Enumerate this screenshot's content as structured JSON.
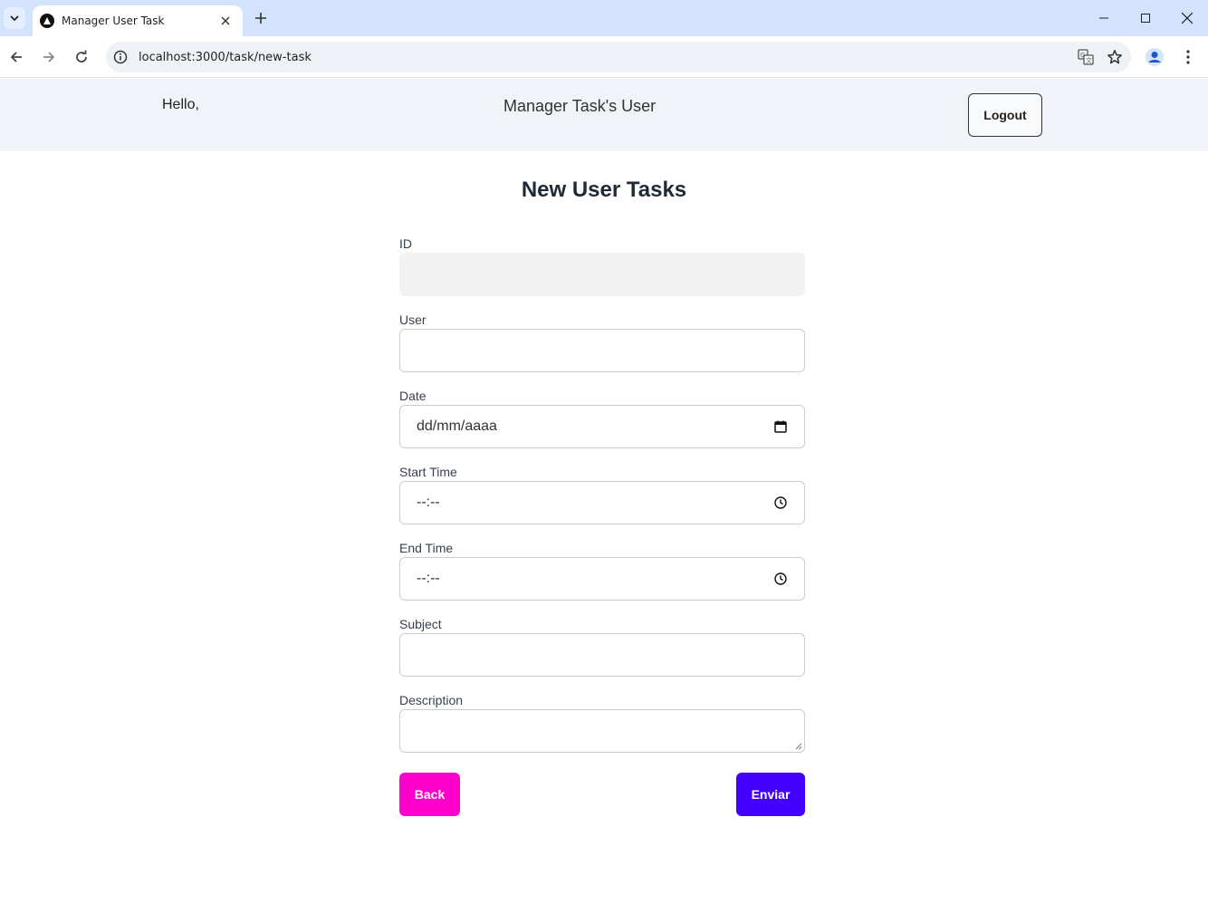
{
  "browser": {
    "tab_title": "Manager User Task",
    "tab_favicon": "nextjs-logo-icon",
    "url": "localhost:3000/task/new-task"
  },
  "header": {
    "greeting": "Hello,",
    "title": "Manager Task's User",
    "logout_label": "Logout"
  },
  "form": {
    "heading": "New User Tasks",
    "fields": {
      "id": {
        "label": "ID",
        "value": ""
      },
      "user": {
        "label": "User",
        "value": ""
      },
      "date": {
        "label": "Date",
        "placeholder": "dd/mm/aaaa"
      },
      "start_time": {
        "label": "Start Time",
        "placeholder": "--:--"
      },
      "end_time": {
        "label": "End Time",
        "placeholder": "--:--"
      },
      "subject": {
        "label": "Subject",
        "value": ""
      },
      "description": {
        "label": "Description",
        "value": ""
      }
    },
    "back_label": "Back",
    "submit_label": "Enviar"
  },
  "colors": {
    "back_button": "#ff00cc",
    "submit_button": "#4400ff",
    "header_bg": "#f0f4f8",
    "tabbar_bg": "#d3e3fd"
  }
}
